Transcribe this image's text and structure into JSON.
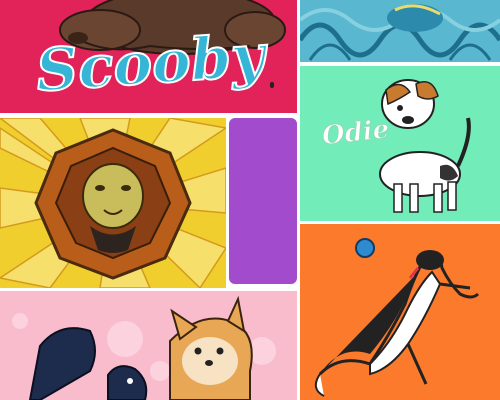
{
  "gallery": {
    "tiles": [
      {
        "label": "Scooby",
        "background": "#e2235a",
        "text_color": "#36b6d7"
      },
      {
        "background": "#36a3c2"
      },
      {
        "background": "#f0ce2e"
      },
      {
        "background": "#a24ccd"
      },
      {
        "label": "Odie",
        "background": "#72ecb8",
        "text_color": "#ffffff"
      },
      {
        "background": "#fb7a2b"
      },
      {
        "background": "#f8bccd"
      }
    ]
  }
}
